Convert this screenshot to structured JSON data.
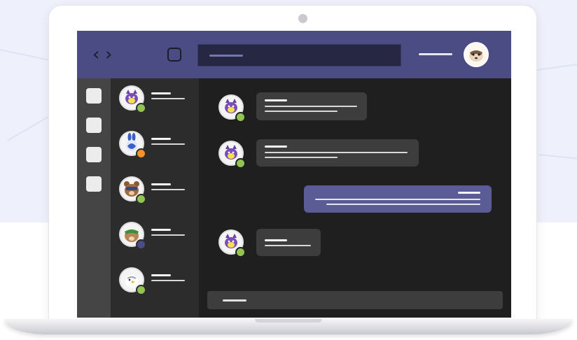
{
  "colors": {
    "topbar": "#4b4c84",
    "rail": "#454545",
    "chat_list": "#2c2c2c",
    "chat_area": "#1f1f1f",
    "bubble_incoming": "#3d3d3d",
    "bubble_outgoing": "#5b5c95",
    "status_available": "#92c353",
    "status_away": "#f7922a",
    "status_offline": "#4b4c84"
  },
  "header": {
    "back_icon": "chevron-left-icon",
    "forward_icon": "chevron-right-icon",
    "compose_icon": "square-icon",
    "user_avatar": "raccoon-mascot"
  },
  "rail": {
    "items": [
      "rail-item-1",
      "rail-item-2",
      "rail-item-3",
      "rail-item-4"
    ]
  },
  "chat_list": {
    "contacts": [
      {
        "mascot": "purple-cat",
        "status": "available"
      },
      {
        "mascot": "blue-rabbit",
        "status": "away"
      },
      {
        "mascot": "bear",
        "status": "available"
      },
      {
        "mascot": "squirrel",
        "status": "offline"
      },
      {
        "mascot": "seagull",
        "status": "available"
      }
    ]
  },
  "messages": [
    {
      "sender": "purple-cat",
      "direction": "incoming",
      "lines": 3
    },
    {
      "sender": "purple-cat",
      "direction": "incoming",
      "lines": 3
    },
    {
      "sender": "me",
      "direction": "outgoing",
      "lines": 3
    },
    {
      "sender": "purple-cat",
      "direction": "incoming",
      "lines": 2
    }
  ]
}
